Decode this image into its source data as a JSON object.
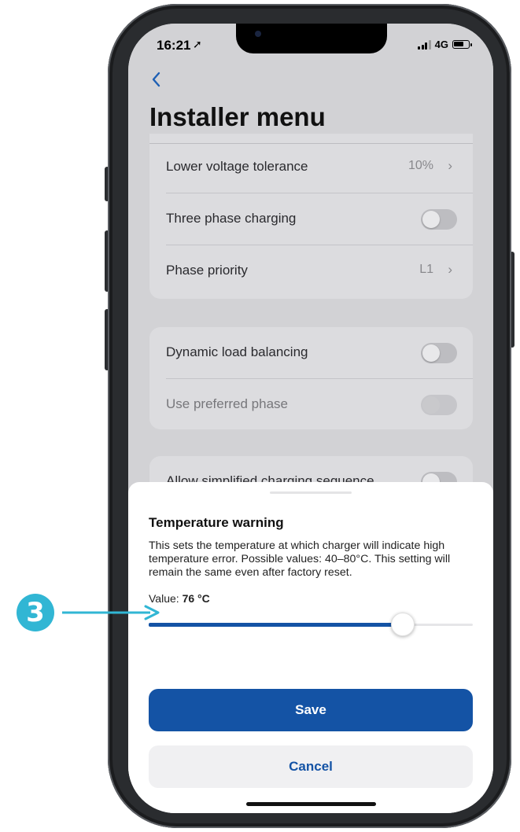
{
  "status_bar": {
    "time": "16:21",
    "network": "4G"
  },
  "nav": {
    "back_icon": "chevron-left-icon",
    "title": "Installer menu"
  },
  "settings_group_1": [
    {
      "label": "Lower voltage tolerance",
      "value": "10%",
      "type": "disclosure"
    },
    {
      "label": "Three phase charging",
      "type": "toggle",
      "on": false
    },
    {
      "label": "Phase priority",
      "value": "L1",
      "type": "disclosure"
    }
  ],
  "settings_group_2": [
    {
      "label": "Dynamic load balancing",
      "type": "toggle",
      "on": false
    },
    {
      "label": "Use preferred phase",
      "type": "toggle",
      "on": false,
      "disabled": true
    }
  ],
  "settings_group_3": [
    {
      "label": "Allow simplified charging sequence",
      "type": "toggle",
      "on": false
    }
  ],
  "sheet": {
    "title": "Temperature warning",
    "description": "This sets the temperature at which charger will indicate high temperature error. Possible values: 40–80°C. This setting will remain the same even after factory reset.",
    "value_label": "Value:",
    "value_text": "76 °C",
    "slider": {
      "min": 40,
      "max": 80,
      "value": 76
    },
    "save_label": "Save",
    "cancel_label": "Cancel"
  },
  "annotation": {
    "step_number": "3"
  },
  "colors": {
    "accent": "#1453a5",
    "annotation": "#31b6d4"
  }
}
